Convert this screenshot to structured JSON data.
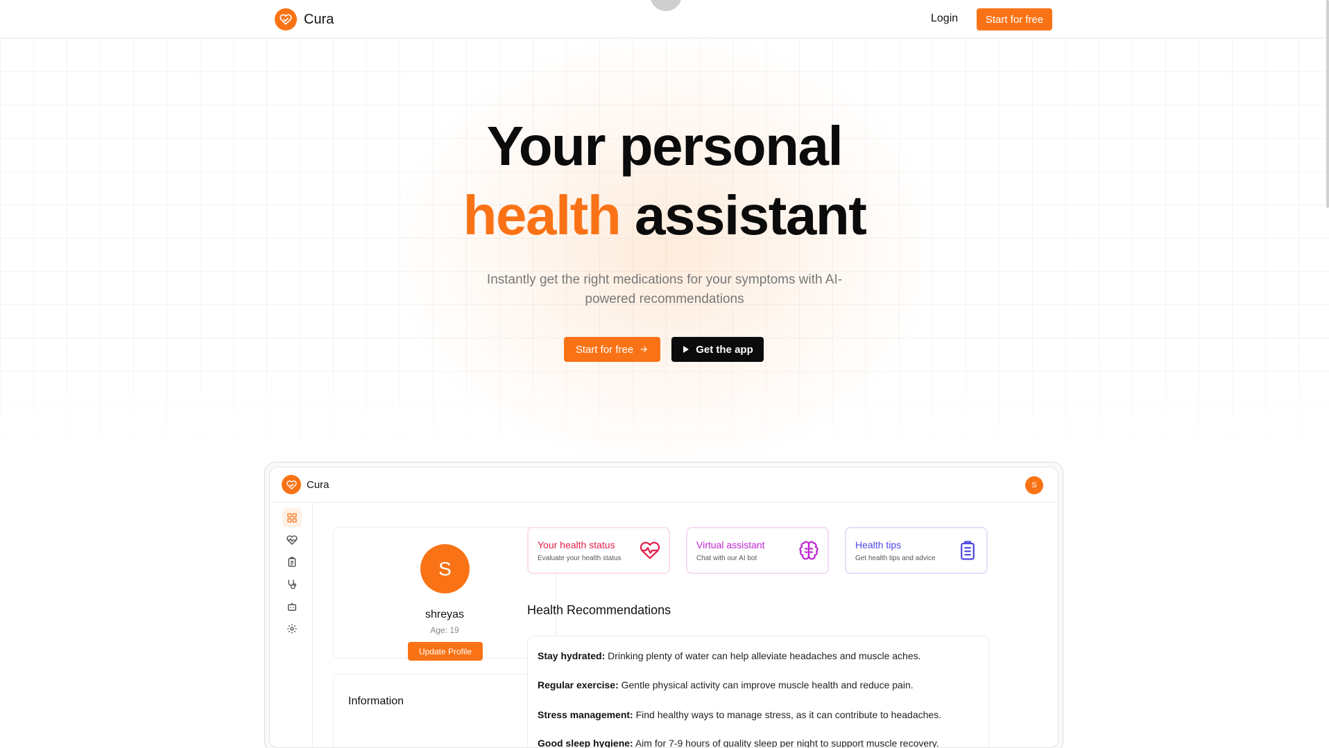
{
  "brand": {
    "name": "Cura",
    "accent": "#f97316"
  },
  "nav": {
    "login_label": "Login",
    "cta_label": "Start for free"
  },
  "hero": {
    "title_line1": "Your personal",
    "title_line2_highlight": "health",
    "title_line2_rest": " assistant",
    "subtitle": "Instantly get the right medications for your symptoms with AI-powered recommendations",
    "primary_cta": "Start for free",
    "secondary_cta": "Get the app"
  },
  "dashboard": {
    "brand_name": "Cura",
    "avatar_initial": "S",
    "sidebar": [
      {
        "icon": "grid-icon",
        "active": true
      },
      {
        "icon": "heart-icon",
        "active": false
      },
      {
        "icon": "clipboard-icon",
        "active": false
      },
      {
        "icon": "stethoscope-icon",
        "active": false
      },
      {
        "icon": "bot-icon",
        "active": false
      },
      {
        "icon": "gear-icon",
        "active": false
      }
    ],
    "profile": {
      "initial": "S",
      "name": "shreyas",
      "age": "Age: 19",
      "update_label": "Update Profile"
    },
    "information_title": "Information",
    "features": [
      {
        "title": "Your health status",
        "subtitle": "Evaluate your health status",
        "icon": "heart-pulse-icon",
        "color": "#e11d48"
      },
      {
        "title": "Virtual assistant",
        "subtitle": "Chat with our AI bot",
        "icon": "brain-icon",
        "color": "#c026d3"
      },
      {
        "title": "Health tips",
        "subtitle": "Get health tips and advice",
        "icon": "clipboard-list-icon",
        "color": "#4f46e5"
      }
    ],
    "recommendations_title": "Health Recommendations",
    "recommendations": [
      {
        "label": "Stay hydrated:",
        "text": " Drinking plenty of water can help alleviate headaches and muscle aches."
      },
      {
        "label": "Regular exercise:",
        "text": " Gentle physical activity can improve muscle health and reduce pain."
      },
      {
        "label": "Stress management:",
        "text": " Find healthy ways to manage stress, as it can contribute to headaches."
      },
      {
        "label": "Good sleep hygiene:",
        "text": " Aim for 7-9 hours of quality sleep per night to support muscle recovery."
      }
    ]
  }
}
